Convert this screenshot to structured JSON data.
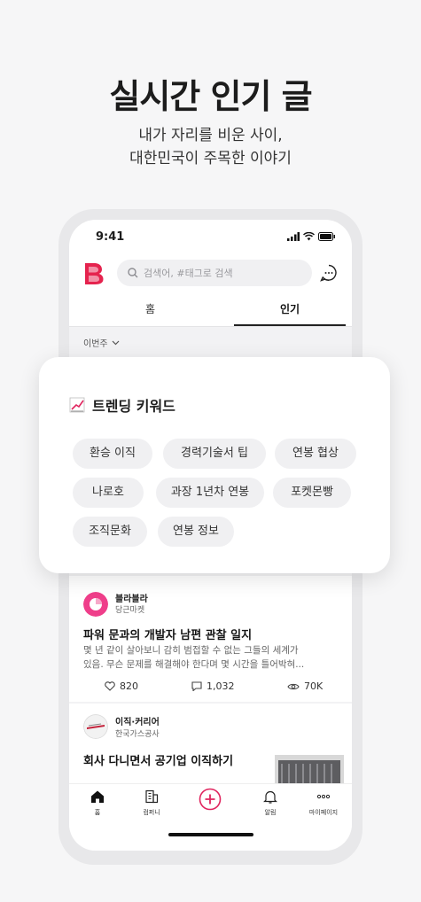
{
  "hero": {
    "title": "실시간 인기 글",
    "subtitle_lines": [
      "내가 자리를 비운 사이,",
      "대한민국이 주목한 이야기"
    ]
  },
  "status_bar": {
    "time": "9:41"
  },
  "search": {
    "placeholder": "검색어, #태그로 검색"
  },
  "tabs": [
    {
      "label": "홈",
      "active": false
    },
    {
      "label": "인기",
      "active": true
    }
  ],
  "filter": {
    "label": "이번주"
  },
  "trending": {
    "title": "트렌딩 키워드",
    "keywords": [
      "환승 이직",
      "경력기술서 팁",
      "연봉 협상",
      "나로호",
      "과장 1년차 연봉",
      "포켓몬빵",
      "조직문화",
      "연봉 정보"
    ]
  },
  "posts": [
    {
      "category": "블라블라",
      "org": "당근마켓",
      "title": "파워 문과의 개발자 남편 관찰 일지",
      "body_lines": [
        "몇 년 같이 살아보니 감히 범접할 수 없는 그들의 세계가",
        "있음. 무슨 문제를 해결해야 한다며 몇 시간을 틀어박혀..."
      ],
      "likes": "820",
      "comments": "1,032",
      "views": "70K"
    },
    {
      "category": "이직·커리어",
      "org": "한국가스공사",
      "title": "회사 다니면서 공기업 이직하기"
    }
  ],
  "bottom_nav": [
    "홈",
    "컴퍼니",
    "",
    "알림",
    "마이페이지"
  ],
  "colors": {
    "brand": "#e5234e",
    "accent": "#e0245e"
  }
}
